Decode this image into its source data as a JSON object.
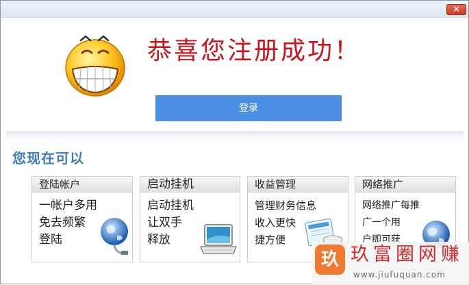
{
  "window": {
    "close_label": "×"
  },
  "headline": "恭喜您注册成功！",
  "login_button": "登录",
  "section_title": "您现在可以",
  "cards": [
    {
      "title": "登陆帐户",
      "lines": [
        "一帐户多用",
        "免去频繁",
        "登陆"
      ],
      "icon": "globe-cable-icon"
    },
    {
      "title": "启动挂机",
      "lines": [
        "启动挂机",
        "让双手",
        "释放"
      ],
      "icon": "laptop-icon"
    },
    {
      "title": "收益管理",
      "lines": [
        "管理财务信息",
        "收入更快",
        "捷方便"
      ],
      "icon": "finance-icon"
    },
    {
      "title": "网络推广",
      "lines": [
        "网络推广每推",
        "广一个用",
        "户即可获"
      ],
      "icon": "globe-icon"
    }
  ],
  "watermark": {
    "logo": "玖",
    "name": "玖富圈网赚",
    "url": "www.jiufuquan.com"
  },
  "colors": {
    "headline": "#c8141b",
    "button": "#4a8fe3",
    "section_title": "#3b7cbf"
  }
}
